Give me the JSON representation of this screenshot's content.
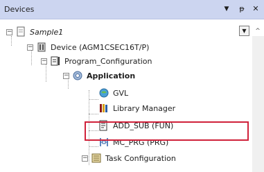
{
  "panel": {
    "title": "Devices",
    "menu_icon": "dropdown-arrow-icon",
    "pin_icon": "pin-icon",
    "close_icon": "close-icon"
  },
  "tree": {
    "project": "Sample1",
    "device": "Device (AGM1CSEC16T/P)",
    "program_configuration": "Program_Configuration",
    "application": "Application",
    "gvl": "GVL",
    "library_manager": "Library Manager",
    "add_sub": "ADD_SUB (FUN)",
    "mc_prg": "MC_PRG (PRG)",
    "task_configuration": "Task Configuration"
  },
  "selected_item": "ADD_SUB (FUN)",
  "colors": {
    "titlebar": "#ccd5f0",
    "highlight_border": "#d0213a"
  }
}
